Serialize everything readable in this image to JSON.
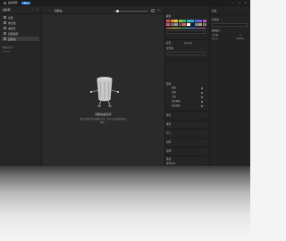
{
  "app": {
    "title": "素材管理",
    "import_label": "导入"
  },
  "window_controls": {
    "minimize": "—",
    "maximize": "□",
    "close": "✕"
  },
  "sidebar": {
    "header": "资料库",
    "items": [
      {
        "label": "全部",
        "icon": "grid-icon",
        "active": false
      },
      {
        "label": "未分类",
        "icon": "inbox-icon",
        "active": false
      },
      {
        "label": "未标签",
        "icon": "tag-icon",
        "active": false
      },
      {
        "label": "近期使用",
        "icon": "clock-icon",
        "active": false
      },
      {
        "label": "回收站",
        "icon": "trash-icon",
        "active": true
      }
    ],
    "section_label": "智能文件夹"
  },
  "topbar": {
    "title": "回收站"
  },
  "empty_state": {
    "title": "回收站是空的",
    "description_lines": [
      "此处会暂时存放您删除的文件，您可以在此恢复或永久",
      "删除。"
    ]
  },
  "filter_panel": {
    "header": "颜色",
    "colors": [
      "#d9534f",
      "#e8823a",
      "#e9c33b",
      "#8fc149",
      "#42b36b",
      "#36b5a8",
      "#3aa0d8",
      "#3f6fd6",
      "#7a58c9",
      "#b157c3",
      "#cf5a8a",
      "#8a6a4f",
      "#9a9a9a",
      "#5a5a5a",
      "#e06060",
      "#ffffff",
      "#1d1d1d",
      "#4f8ad0",
      "#bf9a52",
      "#777777"
    ],
    "color_accent": "#3a8eea",
    "rows": [
      {
        "label": "标签",
        "value": "所有标签"
      },
      {
        "label": "文件夹",
        "value": ""
      }
    ],
    "sections": [
      {
        "label": "形状",
        "items": [
          "横图",
          "竖图",
          "方图",
          "超宽横图",
          "超高竖图"
        ]
      },
      {
        "label": "评分"
      },
      {
        "label": "类型"
      },
      {
        "label": "尺寸"
      },
      {
        "label": "时间"
      },
      {
        "label": "注释"
      },
      {
        "label": "链接"
      },
      {
        "label": "文件大小"
      }
    ]
  },
  "info_panel": {
    "header": "信息",
    "rows": [
      {
        "label": "文件夹"
      },
      {
        "label": "数量统计"
      },
      {
        "label": "文件数",
        "value": "0"
      },
      {
        "label": "总大小",
        "value": "0 Bytes"
      }
    ]
  }
}
